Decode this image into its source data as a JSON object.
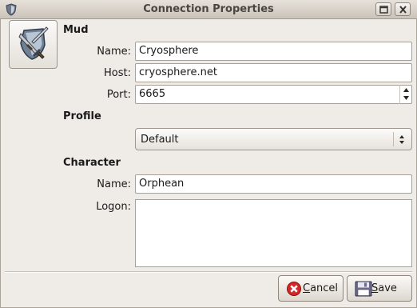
{
  "window": {
    "title": "Connection Properties"
  },
  "mud": {
    "heading": "Mud",
    "name_label": "Name:",
    "name_value": "Cryosphere",
    "host_label": "Host:",
    "host_value": "cryosphere.net",
    "port_label": "Port:",
    "port_value": "6665"
  },
  "profile": {
    "heading": "Profile",
    "selected": "Default"
  },
  "character": {
    "heading": "Character",
    "name_label": "Name:",
    "name_value": "Orphean",
    "logon_label": "Logon:",
    "logon_value": ""
  },
  "buttons": {
    "cancel_label": "Cancel",
    "save_label": "Save"
  },
  "icons": {
    "window": "shield-icon",
    "mud": "shield-sword-icon",
    "cancel": "cancel-icon",
    "save": "floppy-disk-icon"
  }
}
